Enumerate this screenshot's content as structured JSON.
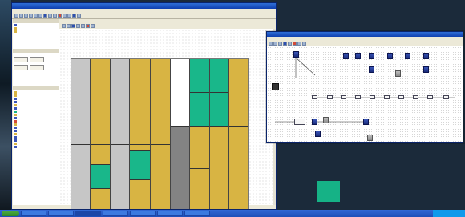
{
  "main_window": {
    "title": "",
    "menu": [],
    "editor_tabs": []
  },
  "left_panel": {
    "buttons": [],
    "tree_items": []
  },
  "overlay_window": {
    "title": "",
    "menu": [],
    "component_labels": []
  },
  "taskbar": {
    "start_label": "",
    "items": [],
    "clock": ""
  },
  "colors": {
    "gray": "#c6c6c6",
    "gold": "#d8b443",
    "teal": "#19b78a",
    "dark_gray": "#838383",
    "component_blue": "#2a43a0",
    "taskbar_blue": "#2459c8"
  }
}
